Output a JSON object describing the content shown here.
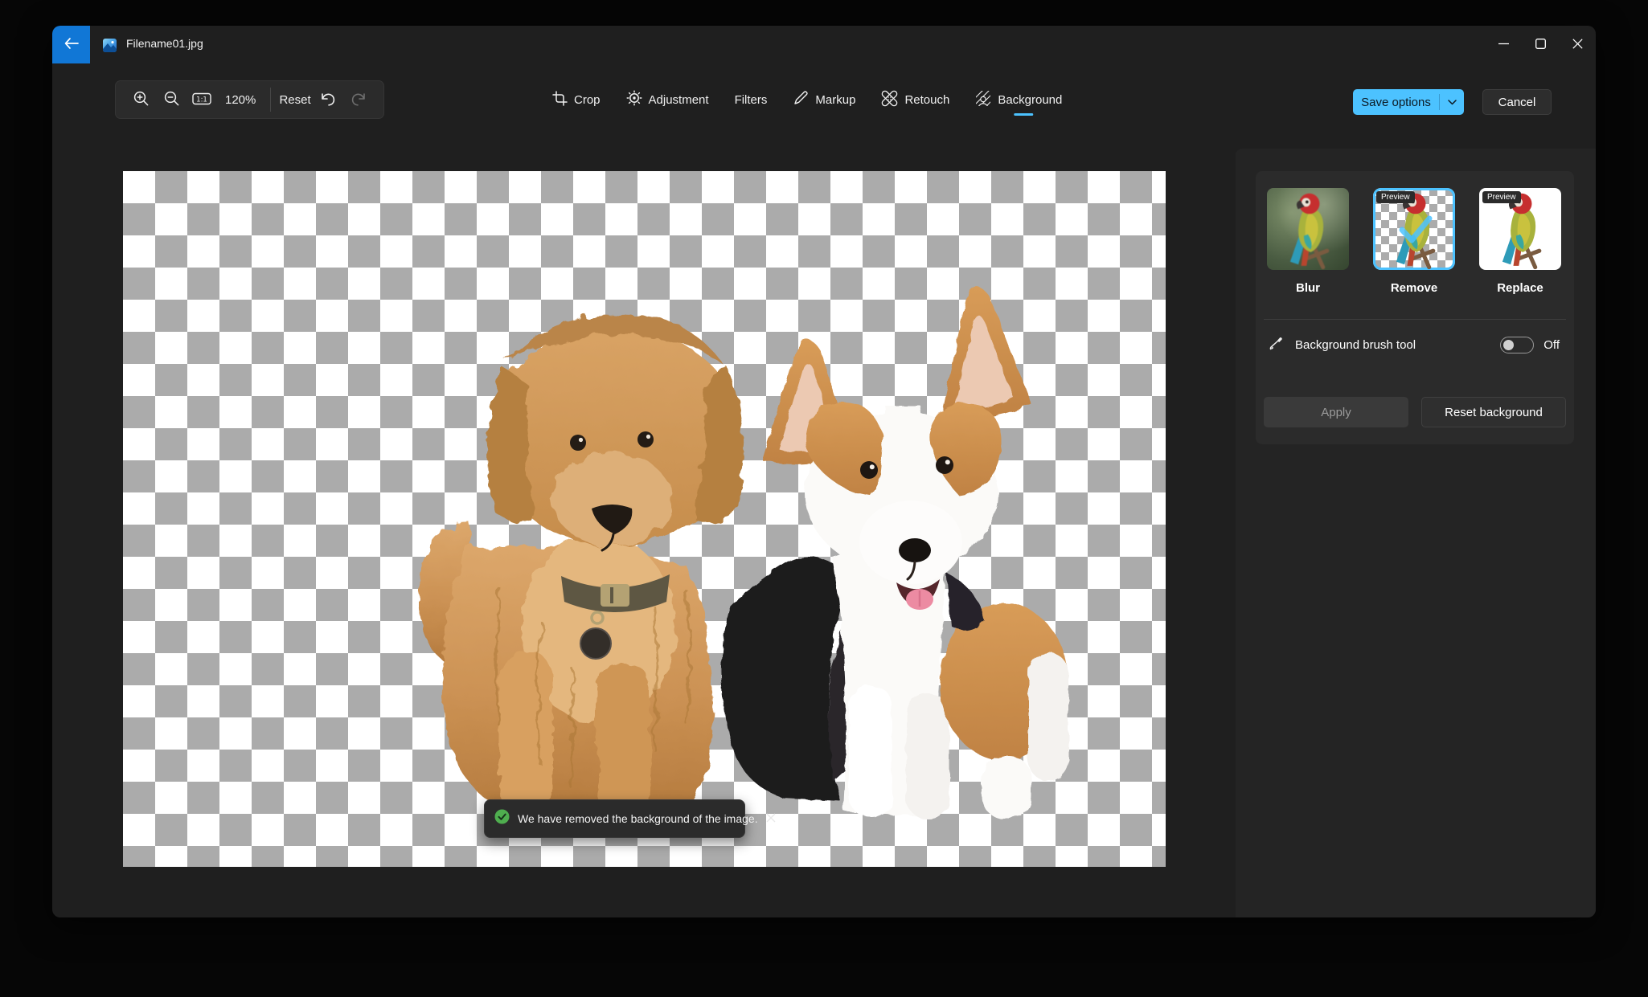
{
  "window": {
    "title": "Filename01.jpg"
  },
  "toolbar": {
    "zoom_level": "120%",
    "reset": "Reset"
  },
  "tabs": [
    {
      "label": "Crop"
    },
    {
      "label": "Adjustment"
    },
    {
      "label": "Filters"
    },
    {
      "label": "Markup"
    },
    {
      "label": "Retouch"
    },
    {
      "label": "Background"
    }
  ],
  "selected_tab": "Background",
  "header_actions": {
    "save": "Save options",
    "cancel": "Cancel"
  },
  "background_panel": {
    "options": [
      {
        "label": "Blur",
        "badge": ""
      },
      {
        "label": "Remove",
        "badge": "Preview"
      },
      {
        "label": "Replace",
        "badge": "Preview"
      }
    ],
    "selected_option": "Remove",
    "brush_label": "Background brush tool",
    "brush_state": "Off",
    "apply": "Apply",
    "reset_background": "Reset background"
  },
  "toast": {
    "message": "We have removed the background of the image."
  },
  "colors": {
    "accent": "#4CC2FF",
    "back_button_blue": "#1177D6",
    "checker_gray": "#ABABAB",
    "toast_green": "#4FAE4F",
    "window_bg": "#1F1F1F",
    "panel_bg": "#242424",
    "card_bg": "#2B2B2B"
  }
}
